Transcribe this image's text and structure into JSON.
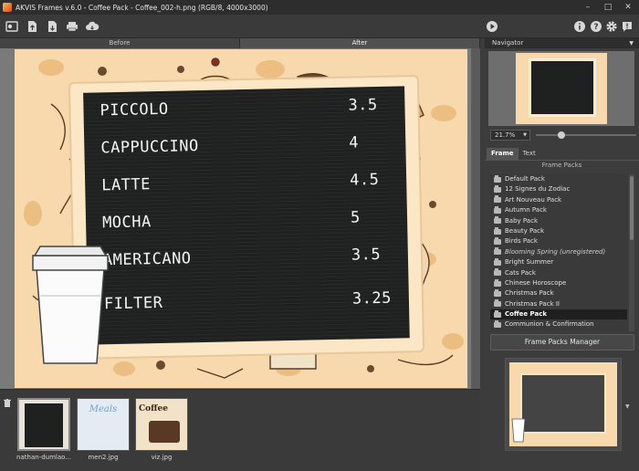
{
  "window": {
    "title": "AKVIS Frames v.6.0 - Coffee Pack - Coffee_002-h.png (RGB/8, 4000x3000)"
  },
  "toolbar": {
    "left_icons": [
      "batch-icon",
      "open-icon",
      "save-icon",
      "print-icon",
      "share-icon"
    ],
    "right_icons": [
      "run-icon",
      "info-icon",
      "help-icon",
      "settings-icon",
      "news-icon"
    ]
  },
  "view_tabs": {
    "before": "Before",
    "after": "After"
  },
  "menu_board": {
    "rows": [
      {
        "name": "PICCOLO",
        "price": "3.5"
      },
      {
        "name": "CAPPUCCINO",
        "price": "4"
      },
      {
        "name": "LATTE",
        "price": "4.5"
      },
      {
        "name": "MOCHA",
        "price": "5"
      },
      {
        "name": "AMERICANO",
        "price": "3.5"
      },
      {
        "name": "FILTER",
        "price": "3.25"
      }
    ]
  },
  "thumbnails": [
    {
      "label": "nathan-dumlao..."
    },
    {
      "label": "men2.jpg",
      "text": "Meals"
    },
    {
      "label": "viz.jpg",
      "text": "Coffee"
    }
  ],
  "navigator": {
    "title": "Navigator",
    "zoom": "21.7%"
  },
  "panel_tabs": {
    "frame": "Frame",
    "text": "Text"
  },
  "frame_packs": {
    "title": "Frame Packs",
    "items": [
      "Default Pack",
      "12 Signes du Zodiac",
      "Art Nouveau Pack",
      "Autumn Pack",
      "Baby Pack",
      "Beauty Pack",
      "Birds Pack",
      "Blooming Spring (unregistered)",
      "Bright Summer",
      "Cats Pack",
      "Chinese Horoscope",
      "Christmas Pack",
      "Christmas Pack II",
      "Coffee Pack",
      "Communion & Confirmation"
    ],
    "selected": "Coffee Pack",
    "manager_button": "Frame Packs Manager"
  },
  "colors": {
    "background": "#3c3c3c",
    "board": "#1f2020",
    "frame_paper": "#f7d9ad"
  }
}
